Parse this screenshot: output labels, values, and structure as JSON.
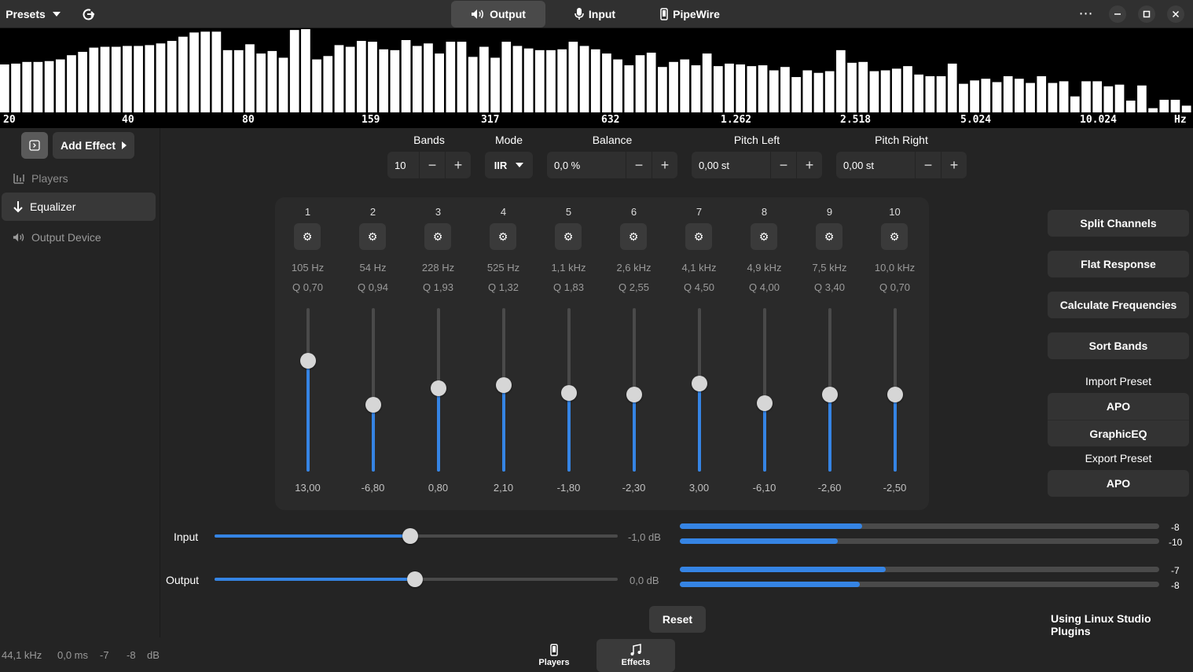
{
  "header": {
    "presets_label": "Presets",
    "tabs": [
      {
        "label": "Output",
        "icon": "speaker-icon",
        "active": true
      },
      {
        "label": "Input",
        "icon": "microphone-icon",
        "active": false
      },
      {
        "label": "PipeWire",
        "icon": "device-icon",
        "active": false
      }
    ],
    "menu_label": "⋯"
  },
  "spectrum": {
    "frequency_labels": [
      "20",
      "40",
      "80",
      "159",
      "317",
      "632",
      "1.262",
      "2.518",
      "5.024",
      "10.024",
      "Hz"
    ],
    "bar_levels": [
      0.57,
      0.58,
      0.6,
      0.6,
      0.61,
      0.63,
      0.68,
      0.72,
      0.77,
      0.78,
      0.78,
      0.79,
      0.79,
      0.8,
      0.82,
      0.85,
      0.9,
      0.95,
      0.96,
      0.96,
      0.74,
      0.74,
      0.81,
      0.7,
      0.73,
      0.65,
      0.98,
      0.99,
      0.63,
      0.67,
      0.8,
      0.78,
      0.85,
      0.84,
      0.75,
      0.74,
      0.86,
      0.79,
      0.82,
      0.7,
      0.84,
      0.84,
      0.66,
      0.78,
      0.65,
      0.84,
      0.79,
      0.76,
      0.74,
      0.74,
      0.75,
      0.84,
      0.79,
      0.75,
      0.7,
      0.63,
      0.56,
      0.68,
      0.71,
      0.54,
      0.6,
      0.63,
      0.56,
      0.7,
      0.55,
      0.58,
      0.57,
      0.55,
      0.56,
      0.5,
      0.54,
      0.42,
      0.5,
      0.47,
      0.49,
      0.74,
      0.59,
      0.6,
      0.49,
      0.5,
      0.52,
      0.55,
      0.45,
      0.43,
      0.43,
      0.58,
      0.34,
      0.38,
      0.4,
      0.36,
      0.43,
      0.4,
      0.35,
      0.43,
      0.35,
      0.37,
      0.19,
      0.37,
      0.37,
      0.31,
      0.33,
      0.14,
      0.32,
      0.05,
      0.15,
      0.15,
      0.08
    ]
  },
  "sidebar": {
    "add_effect_label": "Add Effect",
    "items": [
      {
        "label": "Players",
        "icon": "players-icon"
      },
      {
        "label": "Equalizer",
        "icon": "arrow-down-icon"
      },
      {
        "label": "Output Device",
        "icon": "speaker-icon"
      }
    ]
  },
  "controls": {
    "bands": {
      "label": "Bands",
      "value": "10"
    },
    "mode": {
      "label": "Mode",
      "value": "IIR"
    },
    "balance": {
      "label": "Balance",
      "value": "0,0 %"
    },
    "pitch_left": {
      "label": "Pitch Left",
      "value": "0,00 st"
    },
    "pitch_right": {
      "label": "Pitch Right",
      "value": "0,00 st"
    }
  },
  "eq_bands": [
    {
      "num": "1",
      "freq": "105 Hz",
      "q": "Q 0,70",
      "gain": "13,00",
      "level": 0.68
    },
    {
      "num": "2",
      "freq": "54 Hz",
      "q": "Q 0,94",
      "gain": "-6,80",
      "level": 0.41
    },
    {
      "num": "3",
      "freq": "228 Hz",
      "q": "Q 1,93",
      "gain": "0,80",
      "level": 0.51
    },
    {
      "num": "4",
      "freq": "525 Hz",
      "q": "Q 1,32",
      "gain": "2,10",
      "level": 0.53
    },
    {
      "num": "5",
      "freq": "1,1 kHz",
      "q": "Q 1,83",
      "gain": "-1,80",
      "level": 0.48
    },
    {
      "num": "6",
      "freq": "2,6 kHz",
      "q": "Q 2,55",
      "gain": "-2,30",
      "level": 0.47
    },
    {
      "num": "7",
      "freq": "4,1 kHz",
      "q": "Q 4,50",
      "gain": "3,00",
      "level": 0.54
    },
    {
      "num": "8",
      "freq": "4,9 kHz",
      "q": "Q 4,00",
      "gain": "-6,10",
      "level": 0.42
    },
    {
      "num": "9",
      "freq": "7,5 kHz",
      "q": "Q 3,40",
      "gain": "-2,60",
      "level": 0.47
    },
    {
      "num": "10",
      "freq": "10,0 kHz",
      "q": "Q 0,70",
      "gain": "-2,50",
      "level": 0.47
    }
  ],
  "actions": {
    "split_channels": "Split Channels",
    "flat_response": "Flat Response",
    "calculate_frequencies": "Calculate Frequencies",
    "sort_bands": "Sort Bands",
    "import_preset_label": "Import Preset",
    "import_apo": "APO",
    "import_graphiceq": "GraphicEQ",
    "export_preset_label": "Export Preset",
    "export_apo": "APO"
  },
  "levels": {
    "input": {
      "label": "Input",
      "value": "-1,0 dB",
      "position": 0.485
    },
    "output": {
      "label": "Output",
      "value": "0,0 dB",
      "position": 0.497
    },
    "meters": [
      {
        "value": "-8",
        "level": 0.38
      },
      {
        "value": "-10",
        "level": 0.33
      },
      {
        "value": "-7",
        "level": 0.43
      },
      {
        "value": "-8",
        "level": 0.375
      }
    ]
  },
  "reset_label": "Reset",
  "plugins_label": "Using Linux Studio Plugins",
  "status": {
    "sample_rate": "44,1 kHz",
    "latency": "0,0 ms",
    "level_left": "-7",
    "level_right": "-8",
    "unit": "dB"
  },
  "bottom_tabs": [
    {
      "label": "Players",
      "icon": "players-device-icon"
    },
    {
      "label": "Effects",
      "icon": "music-note-icon",
      "active": true
    }
  ],
  "colors": {
    "accent": "#3584e4",
    "background": "#242424",
    "panel": "#2a2a2a"
  }
}
